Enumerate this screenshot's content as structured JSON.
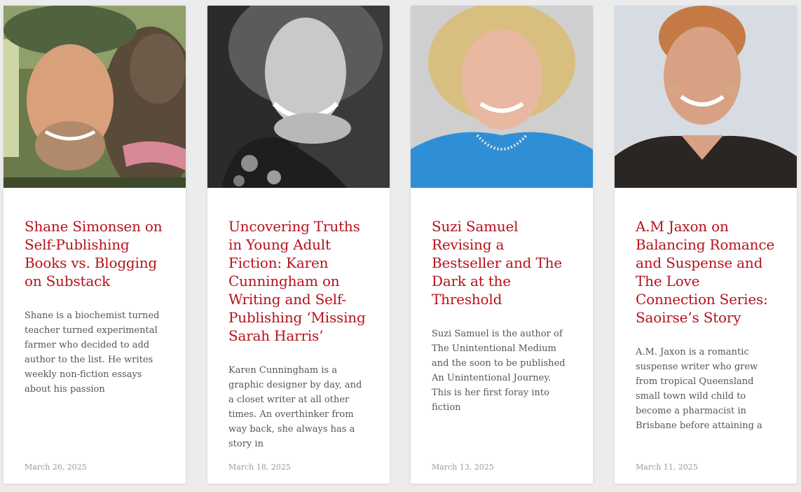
{
  "posts": [
    {
      "title": "Shane Simonsen on Self-Publishing Books vs. Blogging on Substack",
      "excerpt": "Shane is a biochemist turned teacher turned experimental farmer who decided to add author to the list. He writes weekly non-fiction essays about his passion",
      "date": "March 26, 2025",
      "image": "photo-man-with-hat-and-donkey"
    },
    {
      "title": "Uncovering Truths in Young Adult Fiction: Karen Cunningham on Writing and Self-Publishing ‘Missing Sarah Harris’",
      "excerpt": "Karen Cunningham is a graphic designer by day, and a closet writer at all other times. An overthinker from way back, she always has a story in",
      "date": "March 18, 2025",
      "image": "photo-black-and-white-woman-portrait"
    },
    {
      "title": "Suzi Samuel Revising a Bestseller and The Dark at the Threshold",
      "excerpt": "Suzi Samuel is the author of The Unintentional Medium and the soon to be published An Unintentional Journey. This is her first foray into fiction",
      "date": "March 13, 2025",
      "image": "photo-blonde-woman-blue-top"
    },
    {
      "title": "A.M Jaxon on Balancing Romance and Suspense and The Love Connection Series: Saoirse’s Story",
      "excerpt": "A.M. Jaxon is a romantic suspense writer who grew from tropical Queensland small town wild child to become a pharmacist in Brisbane before attaining a",
      "date": "March 11, 2025",
      "image": "photo-short-haired-woman-black-top"
    }
  ],
  "colors": {
    "title": "#b5121b",
    "excerpt": "#555555",
    "date": "#9a9a9a",
    "background": "#ececec",
    "card": "#ffffff"
  }
}
